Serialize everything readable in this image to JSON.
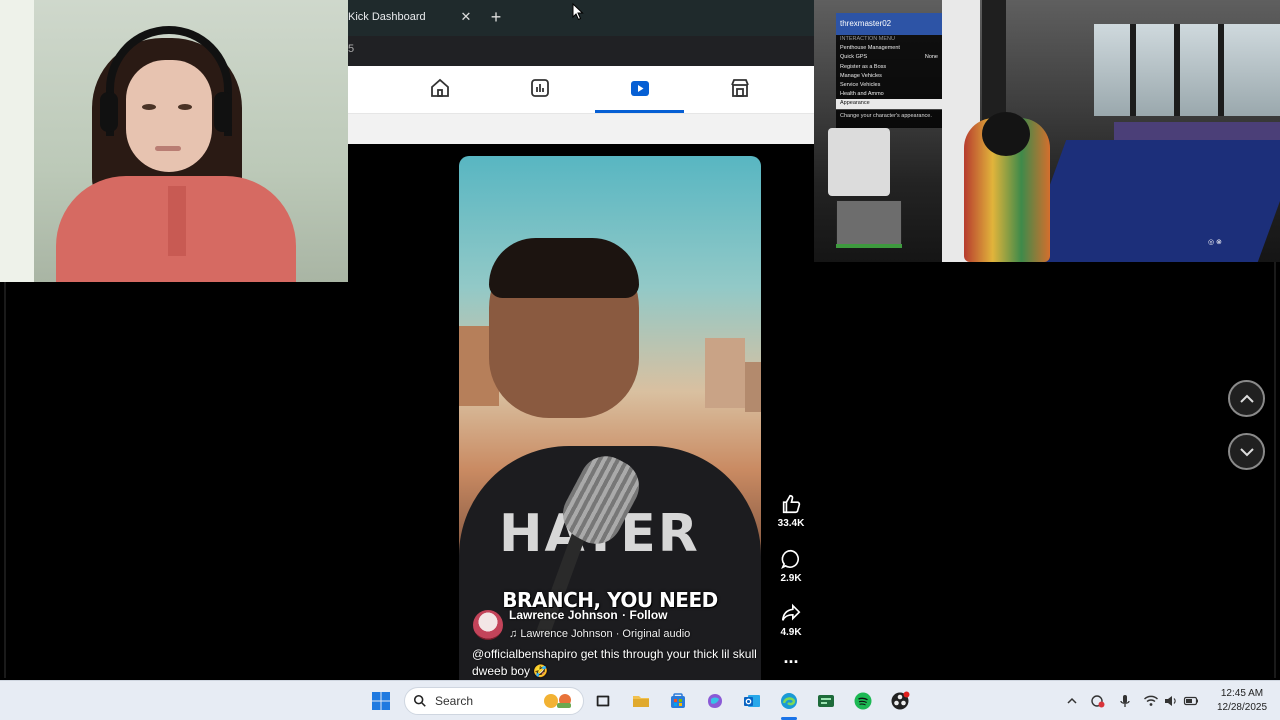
{
  "browser": {
    "tab_title": "Kick Dashboard",
    "tab_close": "✕",
    "new_tab": "+",
    "address_fragment": "5",
    "nav_items": [
      "home-icon",
      "dashboard-icon",
      "shorts-icon",
      "store-icon"
    ],
    "active_nav_index": 2
  },
  "video": {
    "shirt_print": "HATER",
    "caption": "BRANCH, YOU NEED",
    "author": "Lawrence Johnson",
    "follow": "· Follow",
    "audio": "Lawrence Johnson · Original audio",
    "description": "@officialbenshapiro get this through your thick lil skull dweeb boy 🤣"
  },
  "actions": {
    "likes": "33.4K",
    "comments": "2.9K",
    "shares": "4.9K",
    "more": "..."
  },
  "game": {
    "menu_title": "threxmaster02",
    "menu_subtitle": "INTERACTION MENU",
    "menu_items": [
      {
        "label": "Penthouse Management",
        "value": ""
      },
      {
        "label": "Quick GPS",
        "value": "None"
      },
      {
        "label": "Register as a Boss",
        "value": ""
      },
      {
        "label": "Manage Vehicles",
        "value": ""
      },
      {
        "label": "Service Vehicles",
        "value": ""
      },
      {
        "label": "Health and Ammo",
        "value": ""
      },
      {
        "label": "Appearance",
        "value": ""
      }
    ],
    "selected_index": 6,
    "menu_footer": "Change your character's appearance."
  },
  "taskbar": {
    "search_label": "Search",
    "time": "12:45 AM",
    "date": "12/28/2025",
    "apps": [
      "windows-start-icon",
      "search-icon",
      "widgets-icon",
      "task-view-icon",
      "file-explorer-icon",
      "store-icon",
      "copilot-icon",
      "outlook-icon",
      "edge-icon",
      "terminal-icon",
      "spotify-icon",
      "obs-icon"
    ],
    "active_app": "edge-icon"
  },
  "colors": {
    "accent_blue": "#065fd4",
    "taskbar_bg": "#e7ecf4",
    "spotify_green": "#1db954"
  }
}
